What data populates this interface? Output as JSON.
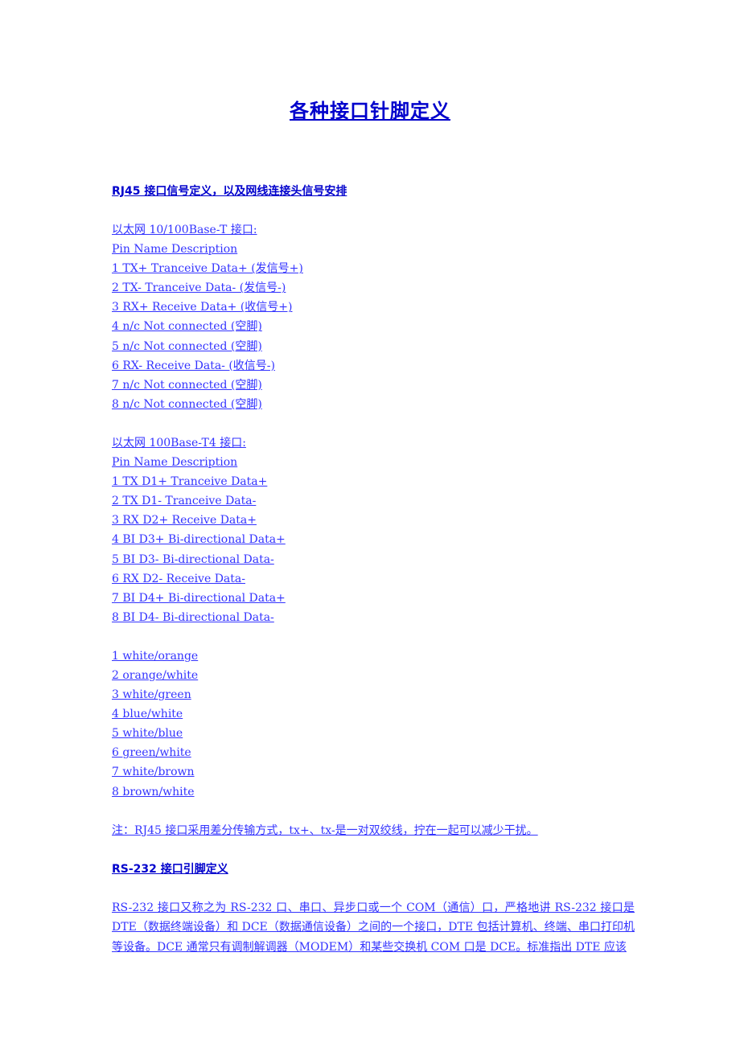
{
  "title": "各种接口针脚定义",
  "rj45": {
    "heading": "RJ45 接口信号定义，以及网线连接头信号安排",
    "base_t": {
      "label": "以太网 10/100Base-T 接口:",
      "header": "Pin Name Description",
      "pins": [
        "1 TX+ Tranceive Data+ (发信号+)",
        "2 TX- Tranceive Data- (发信号-)",
        "3 RX+ Receive Data+ (收信号+)",
        "4 n/c Not connected (空脚)",
        "5 n/c Not connected (空脚)",
        "6 RX- Receive Data- (收信号-)",
        "7 n/c Not connected (空脚)",
        "8 n/c Not connected (空脚)"
      ]
    },
    "base_t4": {
      "label": "以太网 100Base-T4 接口:",
      "header": "Pin Name Description",
      "pins": [
        "1 TX D1+ Tranceive Data+",
        "2 TX D1- Tranceive Data-",
        "3 RX D2+ Receive Data+",
        "4 BI D3+ Bi-directional Data+",
        "5 BI D3- Bi-directional Data-",
        "6 RX D2- Receive Data-",
        "7 BI D4+ Bi-directional Data+",
        "8 BI D4- Bi-directional Data-"
      ]
    },
    "colors": [
      "1 white/orange",
      "2 orange/white",
      "3 white/green",
      "4 blue/white",
      "5 white/blue",
      "6 green/white",
      "7 white/brown",
      "8 brown/white"
    ],
    "note": "注：RJ45 接口采用差分传输方式，tx+、tx-是一对双绞线，拧在一起可以减少干扰。"
  },
  "rs232": {
    "heading": "RS-232 接口引脚定义",
    "paragraph": "RS-232 接口又称之为 RS-232 口、串口、异步口或一个 COM（通信）口，严格地讲 RS-232 接口是 DTE（数据终端设备）和 DCE（数据通信设备）之间的一个接口，DTE 包括计算机、终端、串口打印机等设备。DCE 通常只有调制解调器（MODEM）和某些交换机 COM 口是 DCE。标准指出 DTE 应该"
  }
}
